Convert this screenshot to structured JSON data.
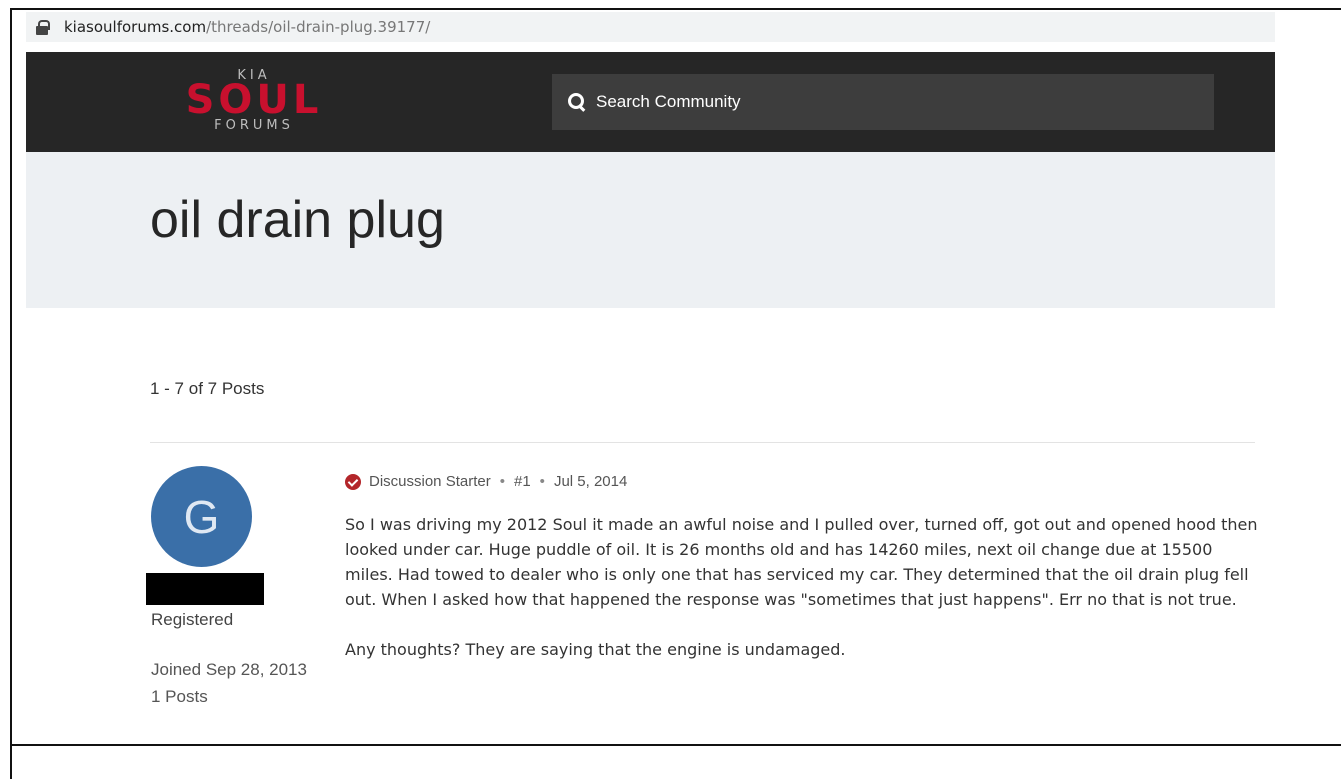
{
  "browser": {
    "url_host": "kiasoulforums.com",
    "url_path": "/threads/oil-drain-plug.39177/"
  },
  "header": {
    "logo": {
      "top": "KIA",
      "main": "SOUL",
      "bottom": "FORUMS"
    },
    "search_placeholder": "Search Community",
    "brand_color": "#c8102e"
  },
  "thread": {
    "title": "oil drain plug",
    "post_count_label": "1 - 7 of 7 Posts"
  },
  "post": {
    "author": {
      "avatar_letter": "G",
      "avatar_color": "#3a6fa8",
      "role": "Registered",
      "joined": "Joined Sep 28, 2013",
      "posts": "1 Posts"
    },
    "badge": "Discussion Starter",
    "number": "#1",
    "date": "Jul 5, 2014",
    "body": [
      "So I was driving my 2012 Soul it made an awful noise and I pulled over, turned off, got out and opened hood then looked under car. Huge puddle of oil. It is 26 months old and has 14260 miles, next oil change due at 15500 miles. Had towed to dealer who is only one that has serviced my car. They determined that the oil drain plug fell out. When I asked how that happened the response was \"sometimes that just happens\". Err no that is not true.",
      "Any thoughts? They are saying that the engine is undamaged."
    ]
  }
}
